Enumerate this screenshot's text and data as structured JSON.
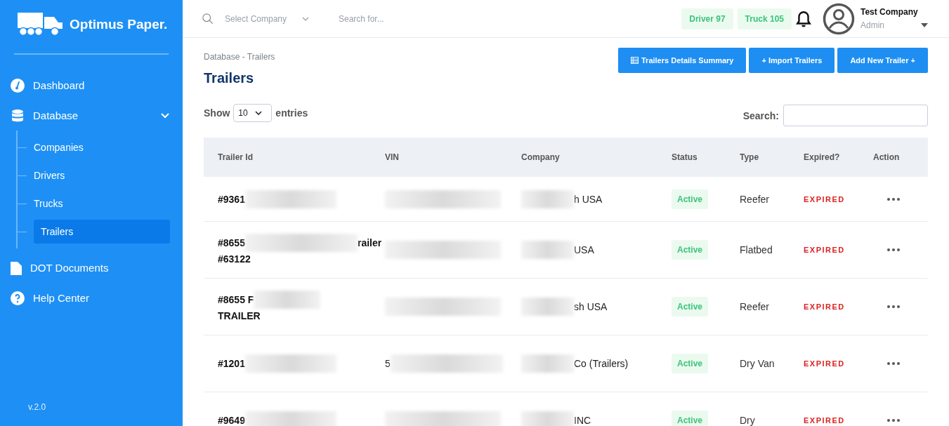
{
  "brand": "Optimus Paper.",
  "nav": [
    {
      "label": "Dashboard"
    },
    {
      "label": "Database",
      "expanded": true,
      "children": [
        {
          "label": "Companies",
          "selected": false
        },
        {
          "label": "Drivers",
          "selected": false
        },
        {
          "label": "Trucks",
          "selected": false
        },
        {
          "label": "Trailers",
          "selected": true
        }
      ]
    },
    {
      "label": "DOT Documents"
    },
    {
      "label": "Help Center"
    }
  ],
  "version": "v.2.0",
  "topbar": {
    "company_placeholder": "Select Company",
    "search_placeholder": "Search for...",
    "counters": [
      "Driver 97",
      "Truck 105"
    ],
    "user": {
      "name": "Test Company",
      "role": "Admin"
    }
  },
  "breadcrumb": "Database - Trailers",
  "title": "Trailers",
  "buttons": [
    "Trailers Details Summary",
    "+ Import Trailers",
    "Add New Trailer +"
  ],
  "entries": {
    "show": "Show",
    "value": "10",
    "suffix": "entries"
  },
  "search_label": "Search:",
  "columns": [
    "Trailer Id",
    "VIN",
    "Company",
    "Status",
    "Type",
    "Expired?",
    "Action"
  ],
  "rows": [
    {
      "trailer_id": [
        {
          "kind": "text",
          "text": "#9361"
        },
        {
          "kind": "blur"
        }
      ],
      "vin": [
        {
          "kind": "blur"
        }
      ],
      "company": [
        {
          "kind": "blur"
        },
        {
          "kind": "text",
          "text": "h USA"
        }
      ],
      "status": "Active",
      "type": "Reefer",
      "expired": "EXPIRED"
    },
    {
      "trailer_id": [
        {
          "kind": "text",
          "text": "#8655"
        },
        {
          "kind": "blur"
        },
        {
          "kind": "text",
          "text": "railer"
        },
        {
          "kind": "break"
        },
        {
          "kind": "text",
          "text": "#63122"
        }
      ],
      "vin": [
        {
          "kind": "blur"
        }
      ],
      "company": [
        {
          "kind": "blur"
        },
        {
          "kind": "text",
          "text": "USA"
        }
      ],
      "status": "Active",
      "type": "Flatbed",
      "expired": "EXPIRED"
    },
    {
      "trailer_id": [
        {
          "kind": "text",
          "text": "#8655 F"
        },
        {
          "kind": "blur"
        },
        {
          "kind": "break"
        },
        {
          "kind": "text",
          "text": "TRAILER"
        }
      ],
      "vin": [
        {
          "kind": "blur"
        }
      ],
      "company": [
        {
          "kind": "blur"
        },
        {
          "kind": "text",
          "text": "sh USA"
        }
      ],
      "status": "Active",
      "type": "Reefer",
      "expired": "EXPIRED"
    },
    {
      "trailer_id": [
        {
          "kind": "text",
          "text": "#1201"
        },
        {
          "kind": "blur"
        }
      ],
      "vin": [
        {
          "kind": "text",
          "text": "5"
        },
        {
          "kind": "blur"
        }
      ],
      "company": [
        {
          "kind": "blur"
        },
        {
          "kind": "text",
          "text": "Co (Trailers)"
        }
      ],
      "status": "Active",
      "type": "Dry Van",
      "expired": "EXPIRED"
    },
    {
      "trailer_id": [
        {
          "kind": "text",
          "text": "#9649"
        },
        {
          "kind": "blur"
        }
      ],
      "vin": [
        {
          "kind": "blur"
        }
      ],
      "company": [
        {
          "kind": "blur"
        },
        {
          "kind": "text",
          "text": "INC"
        }
      ],
      "status": "Active",
      "type": "Dry",
      "expired": "EXPIRED"
    }
  ]
}
